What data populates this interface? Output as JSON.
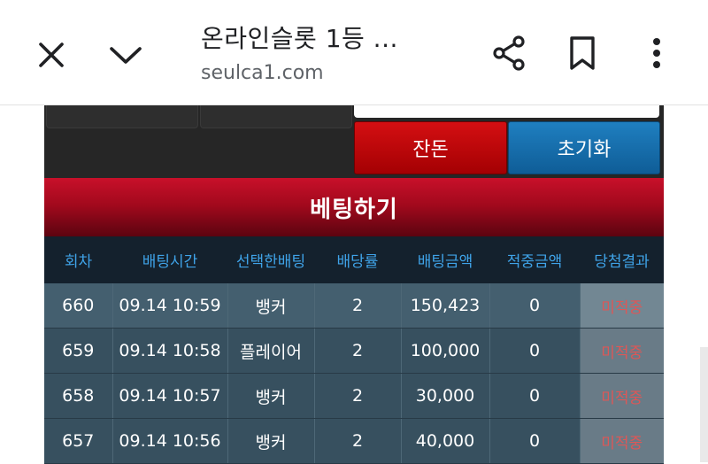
{
  "browser": {
    "title": "온라인슬롯 1등 ...",
    "url": "seulca1.com",
    "icons": [
      "close-icon",
      "chevron-down-icon",
      "share-icon",
      "bookmark-icon",
      "more-vert-icon"
    ]
  },
  "controls": {
    "balance_label": "잔돈",
    "reset_label": "초기화",
    "bet_label": "베팅하기"
  },
  "colors": {
    "banner_red": "#b00c20",
    "header_text_blue": "#3fa3e8",
    "result_red": "#d21f1f",
    "row_bg": "#37505f"
  },
  "table": {
    "headers": [
      "회차",
      "배팅시간",
      "선택한배팅",
      "배당률",
      "배팅금액",
      "적중금액",
      "당첨결과"
    ],
    "rows": [
      [
        "660",
        "09.14 10:59",
        "뱅커",
        "2",
        "150,423",
        "0",
        "미적중"
      ],
      [
        "659",
        "09.14 10:58",
        "플레이어",
        "2",
        "100,000",
        "0",
        "미적중"
      ],
      [
        "658",
        "09.14 10:57",
        "뱅커",
        "2",
        "30,000",
        "0",
        "미적중"
      ],
      [
        "657",
        "09.14 10:56",
        "뱅커",
        "2",
        "40,000",
        "0",
        "미적중"
      ]
    ]
  }
}
